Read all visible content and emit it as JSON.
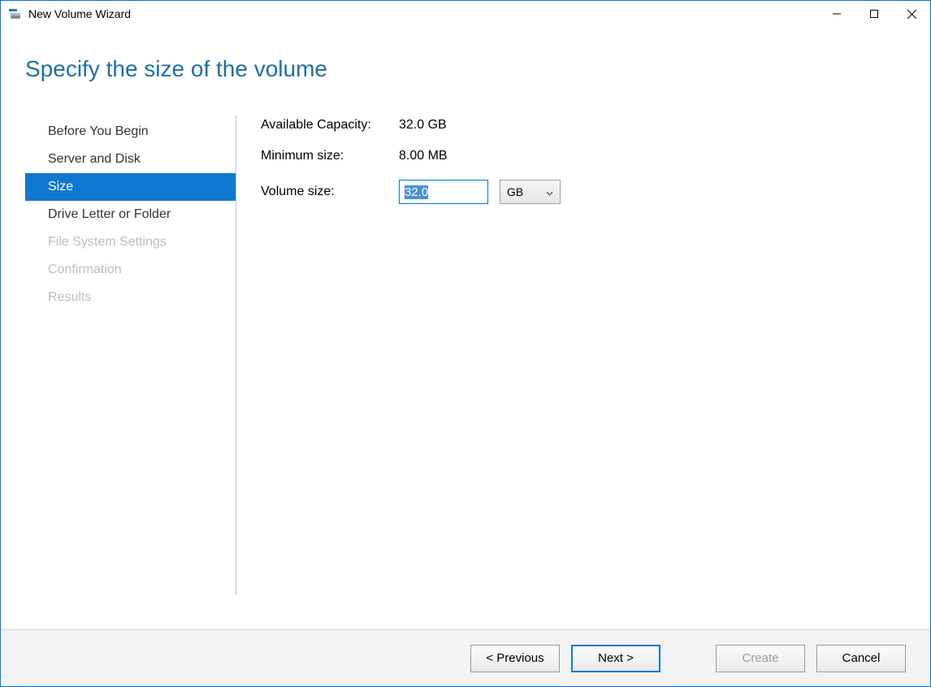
{
  "window": {
    "title": "New Volume Wizard"
  },
  "heading": "Specify the size of the volume",
  "steps": {
    "items": [
      {
        "label": "Before You Begin",
        "state": "enabled"
      },
      {
        "label": "Server and Disk",
        "state": "enabled"
      },
      {
        "label": "Size",
        "state": "active"
      },
      {
        "label": "Drive Letter or Folder",
        "state": "enabled"
      },
      {
        "label": "File System Settings",
        "state": "disabled"
      },
      {
        "label": "Confirmation",
        "state": "disabled"
      },
      {
        "label": "Results",
        "state": "disabled"
      }
    ]
  },
  "content": {
    "available_label": "Available Capacity:",
    "available_value": "32.0 GB",
    "minimum_label": "Minimum size:",
    "minimum_value": "8.00 MB",
    "volume_label": "Volume size:",
    "volume_value": "32.0",
    "unit_selected": "GB"
  },
  "footer": {
    "previous": "< Previous",
    "next": "Next >",
    "create": "Create",
    "cancel": "Cancel"
  }
}
